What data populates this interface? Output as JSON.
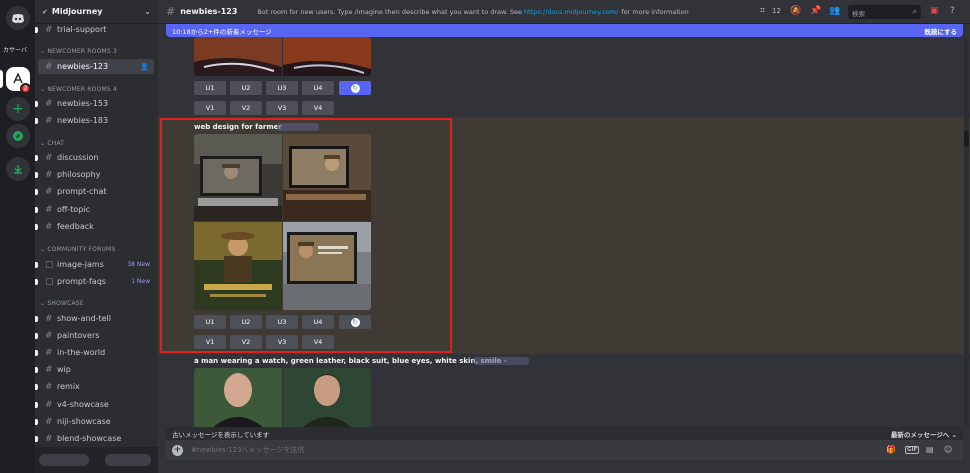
{
  "server_rail": {
    "label": "カサーバ",
    "badge": "2",
    "icons": [
      "discord-home-icon",
      "server-icon",
      "add-server-icon",
      "explore-icon",
      "download-icon"
    ]
  },
  "guild": {
    "name": "Midjourney"
  },
  "sidebar": {
    "pinned": "trial-support",
    "categories": {
      "newcomer3": "NEWCOMER ROOMS 3",
      "newcomer4": "NEWCOMER ROOMS 4",
      "chat": "CHAT",
      "forums": "COMMUNITY FORUMS",
      "showcase": "SHOWCASE"
    },
    "channels": {
      "newbies123": "newbies-123",
      "newbies153": "newbies-153",
      "newbies183": "newbies-183",
      "discussion": "discussion",
      "philosophy": "philosophy",
      "prompt_chat": "prompt-chat",
      "off_topic": "off-topic",
      "feedback": "feedback",
      "image_jams": "image-jams",
      "image_jams_badge": "38 New",
      "prompt_faqs": "prompt-faqs",
      "prompt_faqs_badge": "1 New",
      "show_and_tell": "show-and-tell",
      "paintovers": "paintovers",
      "in_the_world": "in-the-world",
      "wip": "wip",
      "remix": "remix",
      "v4_showcase": "v4-showcase",
      "niji_showcase": "niji-showcase",
      "blend_showcase": "blend-showcase"
    }
  },
  "header": {
    "channel": "newbies-123",
    "topic": "Bot room for new users. Type /imagine then describe what you want to draw. See",
    "topic_link": "https://docs.midjourney.com/",
    "topic_tail": "for more information",
    "thread_count": "12",
    "search_placeholder": "検索"
  },
  "banner": {
    "text": "10:18から2+件の新着メッセージ",
    "mark_read": "既読にする"
  },
  "buttons": {
    "u1": "U1",
    "u2": "U2",
    "u3": "U3",
    "u4": "U4",
    "v1": "V1",
    "v2": "V2",
    "v3": "V3",
    "v4": "V4"
  },
  "messages": {
    "prompt2": "web design for farmer",
    "prompt3": "a man wearing a watch, green leather, black suit, blue eyes, white skin, smile -"
  },
  "footer": {
    "old_messages": "古いメッセージを表示しています",
    "jump_latest": "最新のメッセージへ",
    "composer_placeholder": "#newbies-123へメッセージを送信",
    "gif_label": "GIF"
  }
}
